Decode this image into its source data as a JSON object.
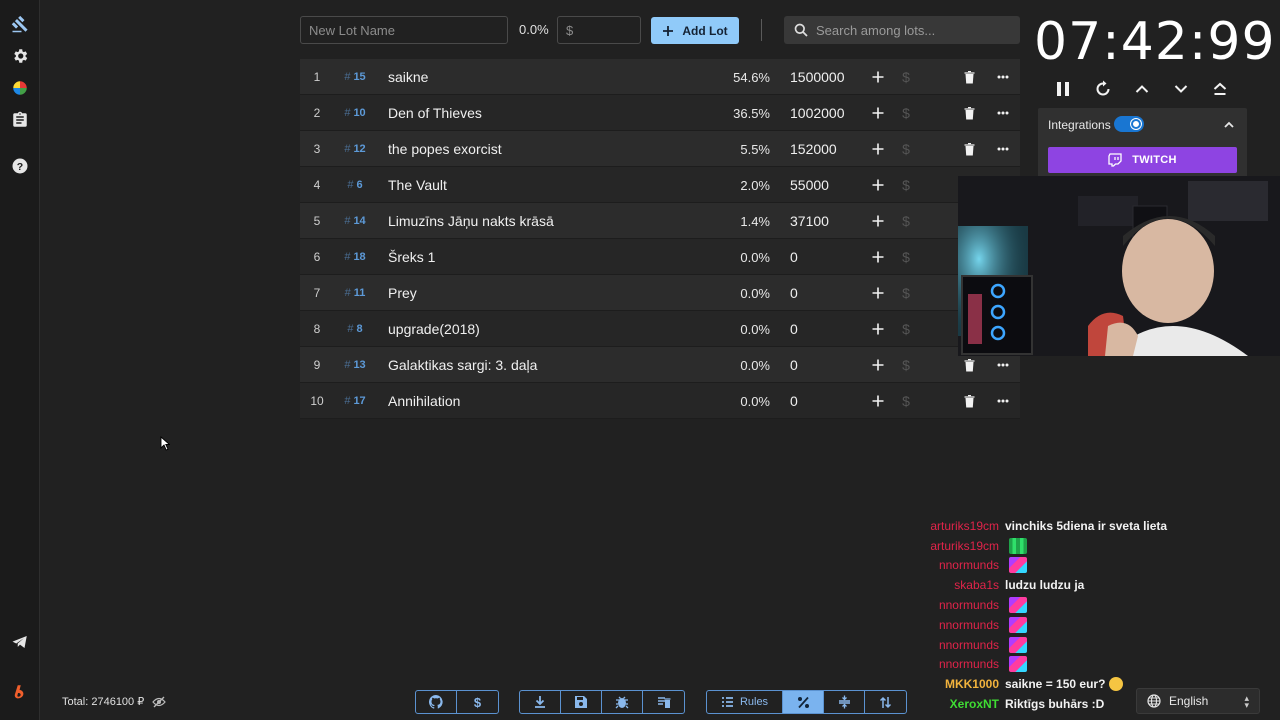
{
  "toolbar": {
    "new_lot_placeholder": "New Lot Name",
    "new_lot_percent": "0.0%",
    "amount_placeholder": "$",
    "add_lot_label": "Add Lot",
    "search_placeholder": "Search among lots..."
  },
  "lots": [
    {
      "index": "1",
      "id": "15",
      "name": "saikne",
      "percent": "54.6%",
      "amount": "1500000"
    },
    {
      "index": "2",
      "id": "10",
      "name": "Den of Thieves",
      "percent": "36.5%",
      "amount": "1002000"
    },
    {
      "index": "3",
      "id": "12",
      "name": "the popes exorcist",
      "percent": "5.5%",
      "amount": "152000"
    },
    {
      "index": "4",
      "id": "6",
      "name": "The Vault",
      "percent": "2.0%",
      "amount": "55000"
    },
    {
      "index": "5",
      "id": "14",
      "name": "Limuzīns Jāņu nakts krāsā",
      "percent": "1.4%",
      "amount": "37100"
    },
    {
      "index": "6",
      "id": "18",
      "name": "Šreks 1",
      "percent": "0.0%",
      "amount": "0"
    },
    {
      "index": "7",
      "id": "11",
      "name": "Prey",
      "percent": "0.0%",
      "amount": "0"
    },
    {
      "index": "8",
      "id": "8",
      "name": "upgrade(2018)",
      "percent": "0.0%",
      "amount": "0"
    },
    {
      "index": "9",
      "id": "13",
      "name": "Galaktikas sargi: 3. daļa",
      "percent": "0.0%",
      "amount": "0"
    },
    {
      "index": "10",
      "id": "17",
      "name": "Annihilation",
      "percent": "0.0%",
      "amount": "0"
    }
  ],
  "timer": {
    "display": "07:42:99"
  },
  "integrations": {
    "label": "Integrations",
    "enabled": true,
    "twitch_label": "TWITCH",
    "twitch_color": "#8e44e2"
  },
  "chat": [
    {
      "user": "arturiks19cm",
      "color": "#e0244a",
      "message": "vinchiks 5diena ir sveta lieta",
      "emote": ""
    },
    {
      "user": "arturiks19cm",
      "color": "#e0244a",
      "message": "",
      "emote": "green"
    },
    {
      "user": "nnormunds",
      "color": "#e0244a",
      "message": "",
      "emote": "rgb"
    },
    {
      "user": "skaba1s",
      "color": "#e0244a",
      "message": "ludzu ludzu ja",
      "emote": ""
    },
    {
      "user": "nnormunds",
      "color": "#e0244a",
      "message": "",
      "emote": "rgb"
    },
    {
      "user": "nnormunds",
      "color": "#e0244a",
      "message": "",
      "emote": "rgb"
    },
    {
      "user": "nnormunds",
      "color": "#e0244a",
      "message": "",
      "emote": "rgb"
    },
    {
      "user": "nnormunds",
      "color": "#e0244a",
      "message": "",
      "emote": "rgb"
    },
    {
      "user": "MKK1000",
      "color": "#f2b33d",
      "message": "saikne = 150 eur?",
      "emote": "grin"
    },
    {
      "user": "XeroxNT",
      "color": "#3fdc33",
      "message": "Riktīgs buhārs :D",
      "emote": ""
    }
  ],
  "footer": {
    "total_label": "Total: 2746100 ₽",
    "rules_label": "Rules",
    "language": "English"
  },
  "colors": {
    "accent": "#90caf9",
    "background": "#212121",
    "lot_id": "#5d9ad8"
  }
}
